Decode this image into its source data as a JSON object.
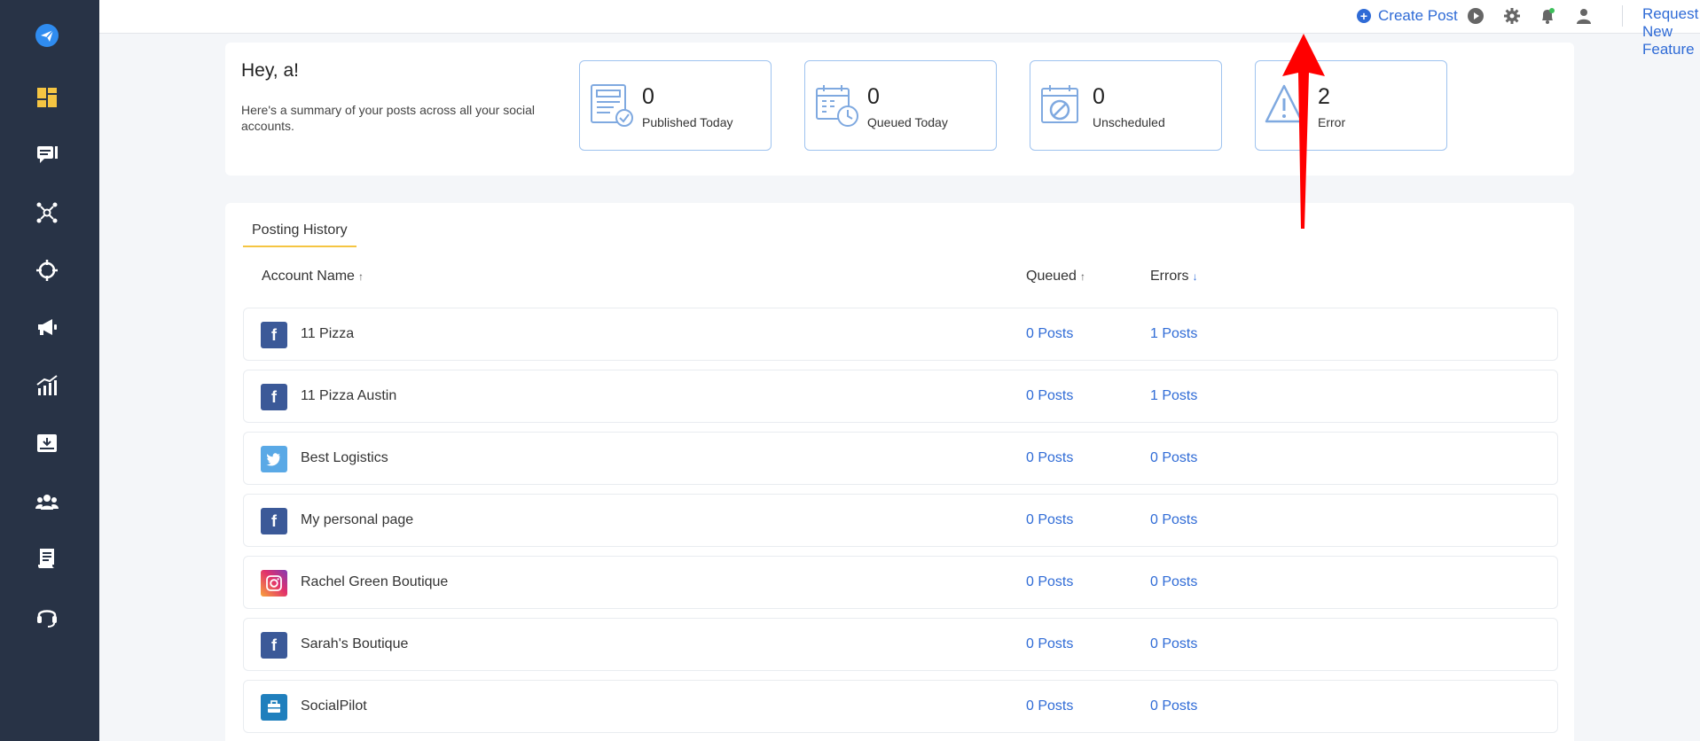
{
  "sidebar": {
    "items": [
      {
        "icon": "send-logo-icon",
        "color": "#2f8cf0"
      },
      {
        "icon": "dashboard-icon",
        "color": "#f5c542"
      },
      {
        "icon": "posts-icon",
        "color": "#ffffff"
      },
      {
        "icon": "connections-icon",
        "color": "#ffffff"
      },
      {
        "icon": "target-icon",
        "color": "#ffffff"
      },
      {
        "icon": "megaphone-icon",
        "color": "#ffffff"
      },
      {
        "icon": "analytics-icon",
        "color": "#ffffff"
      },
      {
        "icon": "inbox-icon",
        "color": "#ffffff"
      },
      {
        "icon": "team-icon",
        "color": "#ffffff"
      },
      {
        "icon": "content-library-icon",
        "color": "#ffffff"
      },
      {
        "icon": "support-headset-icon",
        "color": "#ffffff"
      }
    ]
  },
  "topbar": {
    "create_post": "Create Post",
    "icons": [
      "play-icon",
      "gear-icon",
      "bell-icon",
      "user-icon"
    ],
    "request_feature": "Request New Feature"
  },
  "summary": {
    "greeting": "Hey, a!",
    "description": "Here's a summary of your posts across all your social accounts.",
    "stats": [
      {
        "value": "0",
        "label": "Published Today",
        "icon": "published-icon"
      },
      {
        "value": "0",
        "label": "Queued Today",
        "icon": "queued-calendar-icon"
      },
      {
        "value": "0",
        "label": "Unscheduled",
        "icon": "unscheduled-calendar-icon"
      },
      {
        "value": "2",
        "label": "Error",
        "icon": "warning-icon"
      }
    ]
  },
  "history": {
    "tab": "Posting History",
    "columns": {
      "account": "Account Name",
      "account_sort": "↑",
      "queued": "Queued",
      "queued_sort": "↑",
      "errors": "Errors",
      "errors_sort": "↓"
    },
    "rows": [
      {
        "network": "facebook",
        "name": "11 Pizza",
        "queued": "0 Posts",
        "errors": "1 Posts"
      },
      {
        "network": "facebook",
        "name": "11 Pizza Austin",
        "queued": "0 Posts",
        "errors": "1 Posts"
      },
      {
        "network": "twitter",
        "name": "Best Logistics",
        "queued": "0 Posts",
        "errors": "0 Posts"
      },
      {
        "network": "facebook",
        "name": "My personal page",
        "queued": "0 Posts",
        "errors": "0 Posts"
      },
      {
        "network": "instagram",
        "name": "Rachel Green Boutique",
        "queued": "0 Posts",
        "errors": "0 Posts"
      },
      {
        "network": "facebook",
        "name": "Sarah's Boutique",
        "queued": "0 Posts",
        "errors": "0 Posts"
      },
      {
        "network": "socialpilot",
        "name": "SocialPilot",
        "queued": "0 Posts",
        "errors": "0 Posts"
      }
    ]
  },
  "colors": {
    "sidebar_bg": "#283346",
    "accent_blue": "#2f6bd6",
    "accent_yellow": "#f5c542",
    "stat_border": "#9fc3ef",
    "annotation_red": "#ff0000"
  }
}
